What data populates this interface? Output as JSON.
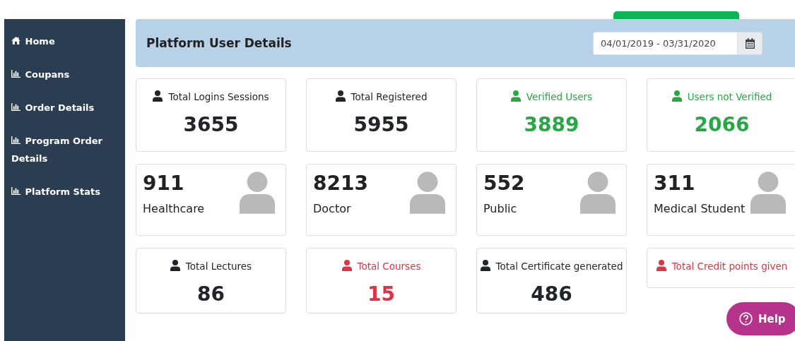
{
  "sidebar": {
    "items": [
      {
        "label": "Home",
        "kind": "home"
      },
      {
        "label": "Coupans",
        "kind": "chart"
      },
      {
        "label": "Order Details",
        "kind": "chart"
      },
      {
        "label": "Program Order Details",
        "kind": "chart"
      },
      {
        "label": "Platform Stats",
        "kind": "chart"
      }
    ]
  },
  "header": {
    "title": "Platform User Details",
    "date_range": "04/01/2019 - 03/31/2020"
  },
  "cards": [
    {
      "kind": "count",
      "color": "#212529",
      "label": "Total Logins Sessions",
      "value": "3655"
    },
    {
      "kind": "count",
      "color": "#212529",
      "label": "Total Registered",
      "value": "5955"
    },
    {
      "kind": "count",
      "color": "#28a745",
      "label": "Verified Users",
      "value": "3889"
    },
    {
      "kind": "count",
      "color": "#28a745",
      "label": "Users not Verified",
      "value": "2066"
    },
    {
      "kind": "avatar",
      "label": "Healthcare",
      "value": "911"
    },
    {
      "kind": "avatar",
      "label": "Doctor",
      "value": "8213"
    },
    {
      "kind": "avatar",
      "label": "Public",
      "value": "552"
    },
    {
      "kind": "avatar",
      "label": "Medical Student",
      "value": "311"
    },
    {
      "kind": "count",
      "color": "#212529",
      "label": "Total Lectures",
      "value": "86"
    },
    {
      "kind": "count",
      "color": "#dc3545",
      "label": "Total Courses",
      "value": "15"
    },
    {
      "kind": "count",
      "color": "#212529",
      "label": "Total Certificate generated",
      "value": "486"
    },
    {
      "kind": "count",
      "color": "#dc3545",
      "label": "Total Credit points given"
    }
  ],
  "help": {
    "label": "Help"
  }
}
